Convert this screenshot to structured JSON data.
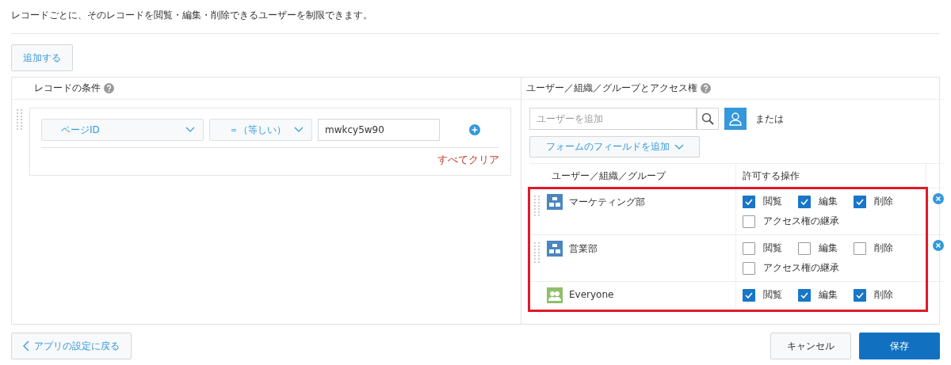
{
  "description": "レコードごとに、そのレコードを閲覧・編集・削除できるユーザーを制限できます。",
  "add_button": "追加する",
  "conditions": {
    "title": "レコードの条件",
    "field": "ページID",
    "operator": "＝（等しい）",
    "value": "mwkcy5w90",
    "clear": "すべてクリア"
  },
  "access": {
    "title": "ユーザー／組織／グループとアクセス権",
    "search": {
      "placeholder": "ユーザーを追加"
    },
    "or_label": "または",
    "field_dropdown": "フォームのフィールドを追加",
    "columns": [
      "ユーザー／組織／グループ",
      "許可する操作"
    ],
    "rows": [
      {
        "name": "マーケティング部",
        "kind": "organization",
        "removable": true,
        "permissions": [
          {
            "label": "閲覧",
            "checked": true
          },
          {
            "label": "編集",
            "checked": true
          },
          {
            "label": "削除",
            "checked": true
          }
        ],
        "inherit": {
          "label": "アクセス権の継承",
          "checked": false
        }
      },
      {
        "name": "営業部",
        "kind": "organization",
        "removable": true,
        "permissions": [
          {
            "label": "閲覧",
            "checked": false
          },
          {
            "label": "編集",
            "checked": false
          },
          {
            "label": "削除",
            "checked": false
          }
        ],
        "inherit": {
          "label": "アクセス権の継承",
          "checked": false
        }
      },
      {
        "name": "Everyone",
        "kind": "everyone",
        "removable": false,
        "permissions": [
          {
            "label": "閲覧",
            "checked": true
          },
          {
            "label": "編集",
            "checked": true
          },
          {
            "label": "削除",
            "checked": true
          }
        ]
      }
    ]
  },
  "footer": {
    "back": "アプリの設定に戻る",
    "cancel": "キャンセル",
    "save": "保存"
  }
}
